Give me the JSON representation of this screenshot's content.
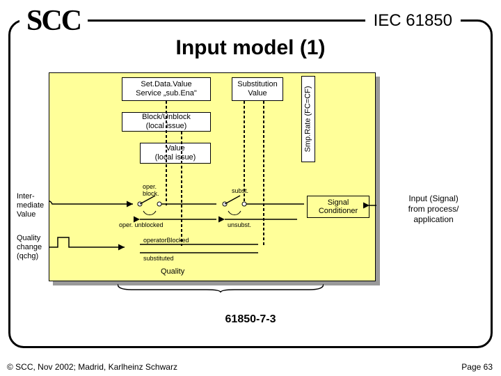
{
  "header": {
    "scc": "SCC",
    "iec": "IEC 61850",
    "title": "Input model (1)"
  },
  "boxes": {
    "setdata_l1": "Set.Data.Value",
    "setdata_l2": "Service „sub.Ena\"",
    "subst_l1": "Substitution",
    "subst_l2": "Value",
    "block_l1": "Block/Unblock",
    "block_l2": "(local issue)",
    "value_l1": "Value",
    "value_l2": "(local issue)",
    "smprate": "Smp.Rate (FC=CF)",
    "sigcond": "Signal\nConditioner"
  },
  "labels": {
    "oper_block_l1": "oper.",
    "oper_block_l2": "block.",
    "oper_unblocked": "oper. unblocked",
    "subst": "subst.",
    "unsubst": "unsubst.",
    "operatorBlocked": "operatorBlocked",
    "substituted": "substituted",
    "quality": "Quality"
  },
  "side": {
    "intermediate_l1": "Inter-",
    "intermediate_l2": "mediate",
    "intermediate_l3": "Value",
    "qchg_l1": "Quality",
    "qchg_l2": "change",
    "qchg_l3": "(qchg)",
    "input_l1": "Input (Signal)",
    "input_l2": "from process/",
    "input_l3": "application"
  },
  "footer": {
    "clause": "61850-7-3",
    "copyright": "© SCC, Nov 2002; Madrid, Karlheinz Schwarz",
    "page": "Page 63"
  }
}
